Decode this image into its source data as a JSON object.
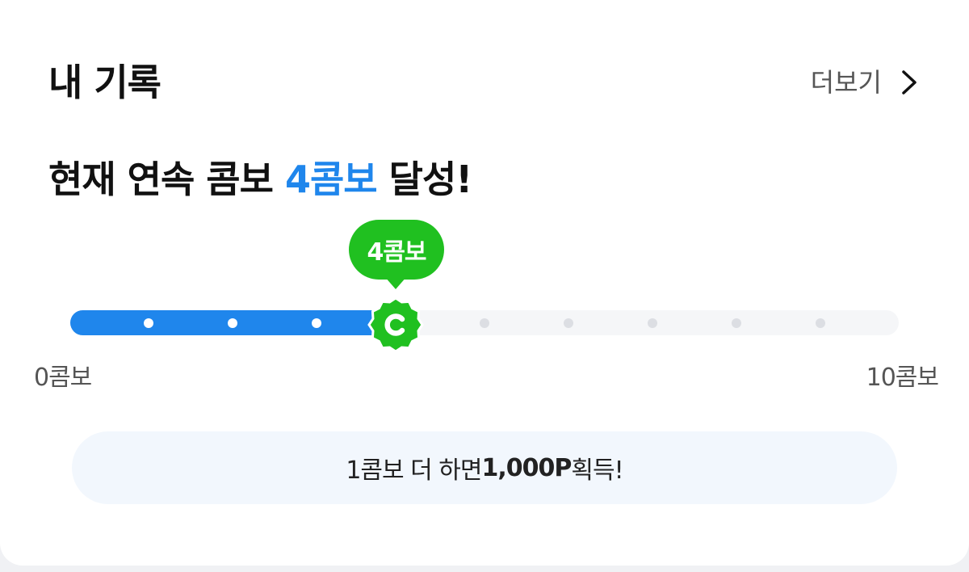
{
  "header": {
    "title": "내 기록",
    "more_label": "더보기",
    "more_icon": "chevron-right-icon"
  },
  "headline": {
    "prefix": "현재 연속 콤보 ",
    "highlight": "4콤보",
    "suffix": " 달성!"
  },
  "progress": {
    "current": 4,
    "max": 10,
    "current_label": "4콤보",
    "min_label": "0콤보",
    "max_label": "10콤보",
    "marker_icon": "combo-badge-icon"
  },
  "reward": {
    "prefix": "1콤보 더 하면 ",
    "points": "1,000P",
    "suffix": " 획득!"
  },
  "colors": {
    "accent": "#1f86ec",
    "badge": "#20c020",
    "track": "#f5f6f8",
    "reward_bg": "#f2f7fd"
  }
}
